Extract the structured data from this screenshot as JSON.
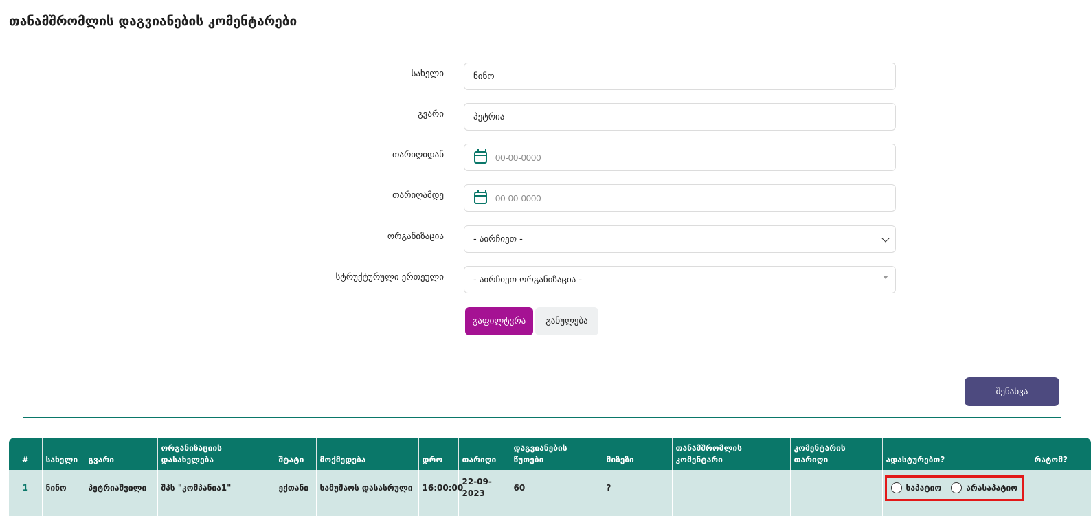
{
  "page": {
    "title": "თანამშრომლის დაგვიანების კომენტარები"
  },
  "form": {
    "name": {
      "label": "სახელი",
      "value": "ნინო"
    },
    "surname": {
      "label": "გვარი",
      "value": "პეტრია"
    },
    "date_from": {
      "label": "თარიღიდან",
      "placeholder": "00-00-0000"
    },
    "date_to": {
      "label": "თარიღამდე",
      "placeholder": "00-00-0000"
    },
    "organization": {
      "label": "ორგანიზაცია",
      "selected": "- აირჩიეთ -"
    },
    "structural_unit": {
      "label": "სტრუქტურული ერთეული",
      "selected": "- აირჩიეთ ორგანიზაცია -"
    },
    "filter_label": "გაფილტვრა",
    "reset_label": "განულება"
  },
  "save_label": "შენახვა",
  "table": {
    "headers": [
      "#",
      "სახელი",
      "გვარი",
      "ორგანიზაციის დასახელება",
      "შტატი",
      "მოქმედება",
      "დრო",
      "თარიღი",
      "დაგვიანების წუთები",
      "მიზეზი",
      "თანამშრომლის კომენტარი",
      "კომენტარის თარიღი",
      "ადასტურებთ?",
      "რატომ?"
    ],
    "rows": [
      {
        "num": "1",
        "name": "ნინო",
        "surname": "პეტრიაშვილი",
        "organization": "შპს \"კომპანია1\"",
        "staff": "ექთანი",
        "action": "სამუშაოს დასასრული",
        "time": "16:00:00",
        "date": "22-09-2023",
        "late_minutes": "60",
        "reason": "?",
        "employee_comment": "",
        "comment_date": "",
        "confirm_options": [
          "საპატიო",
          "არასაპატიო"
        ],
        "why": ""
      }
    ]
  }
}
